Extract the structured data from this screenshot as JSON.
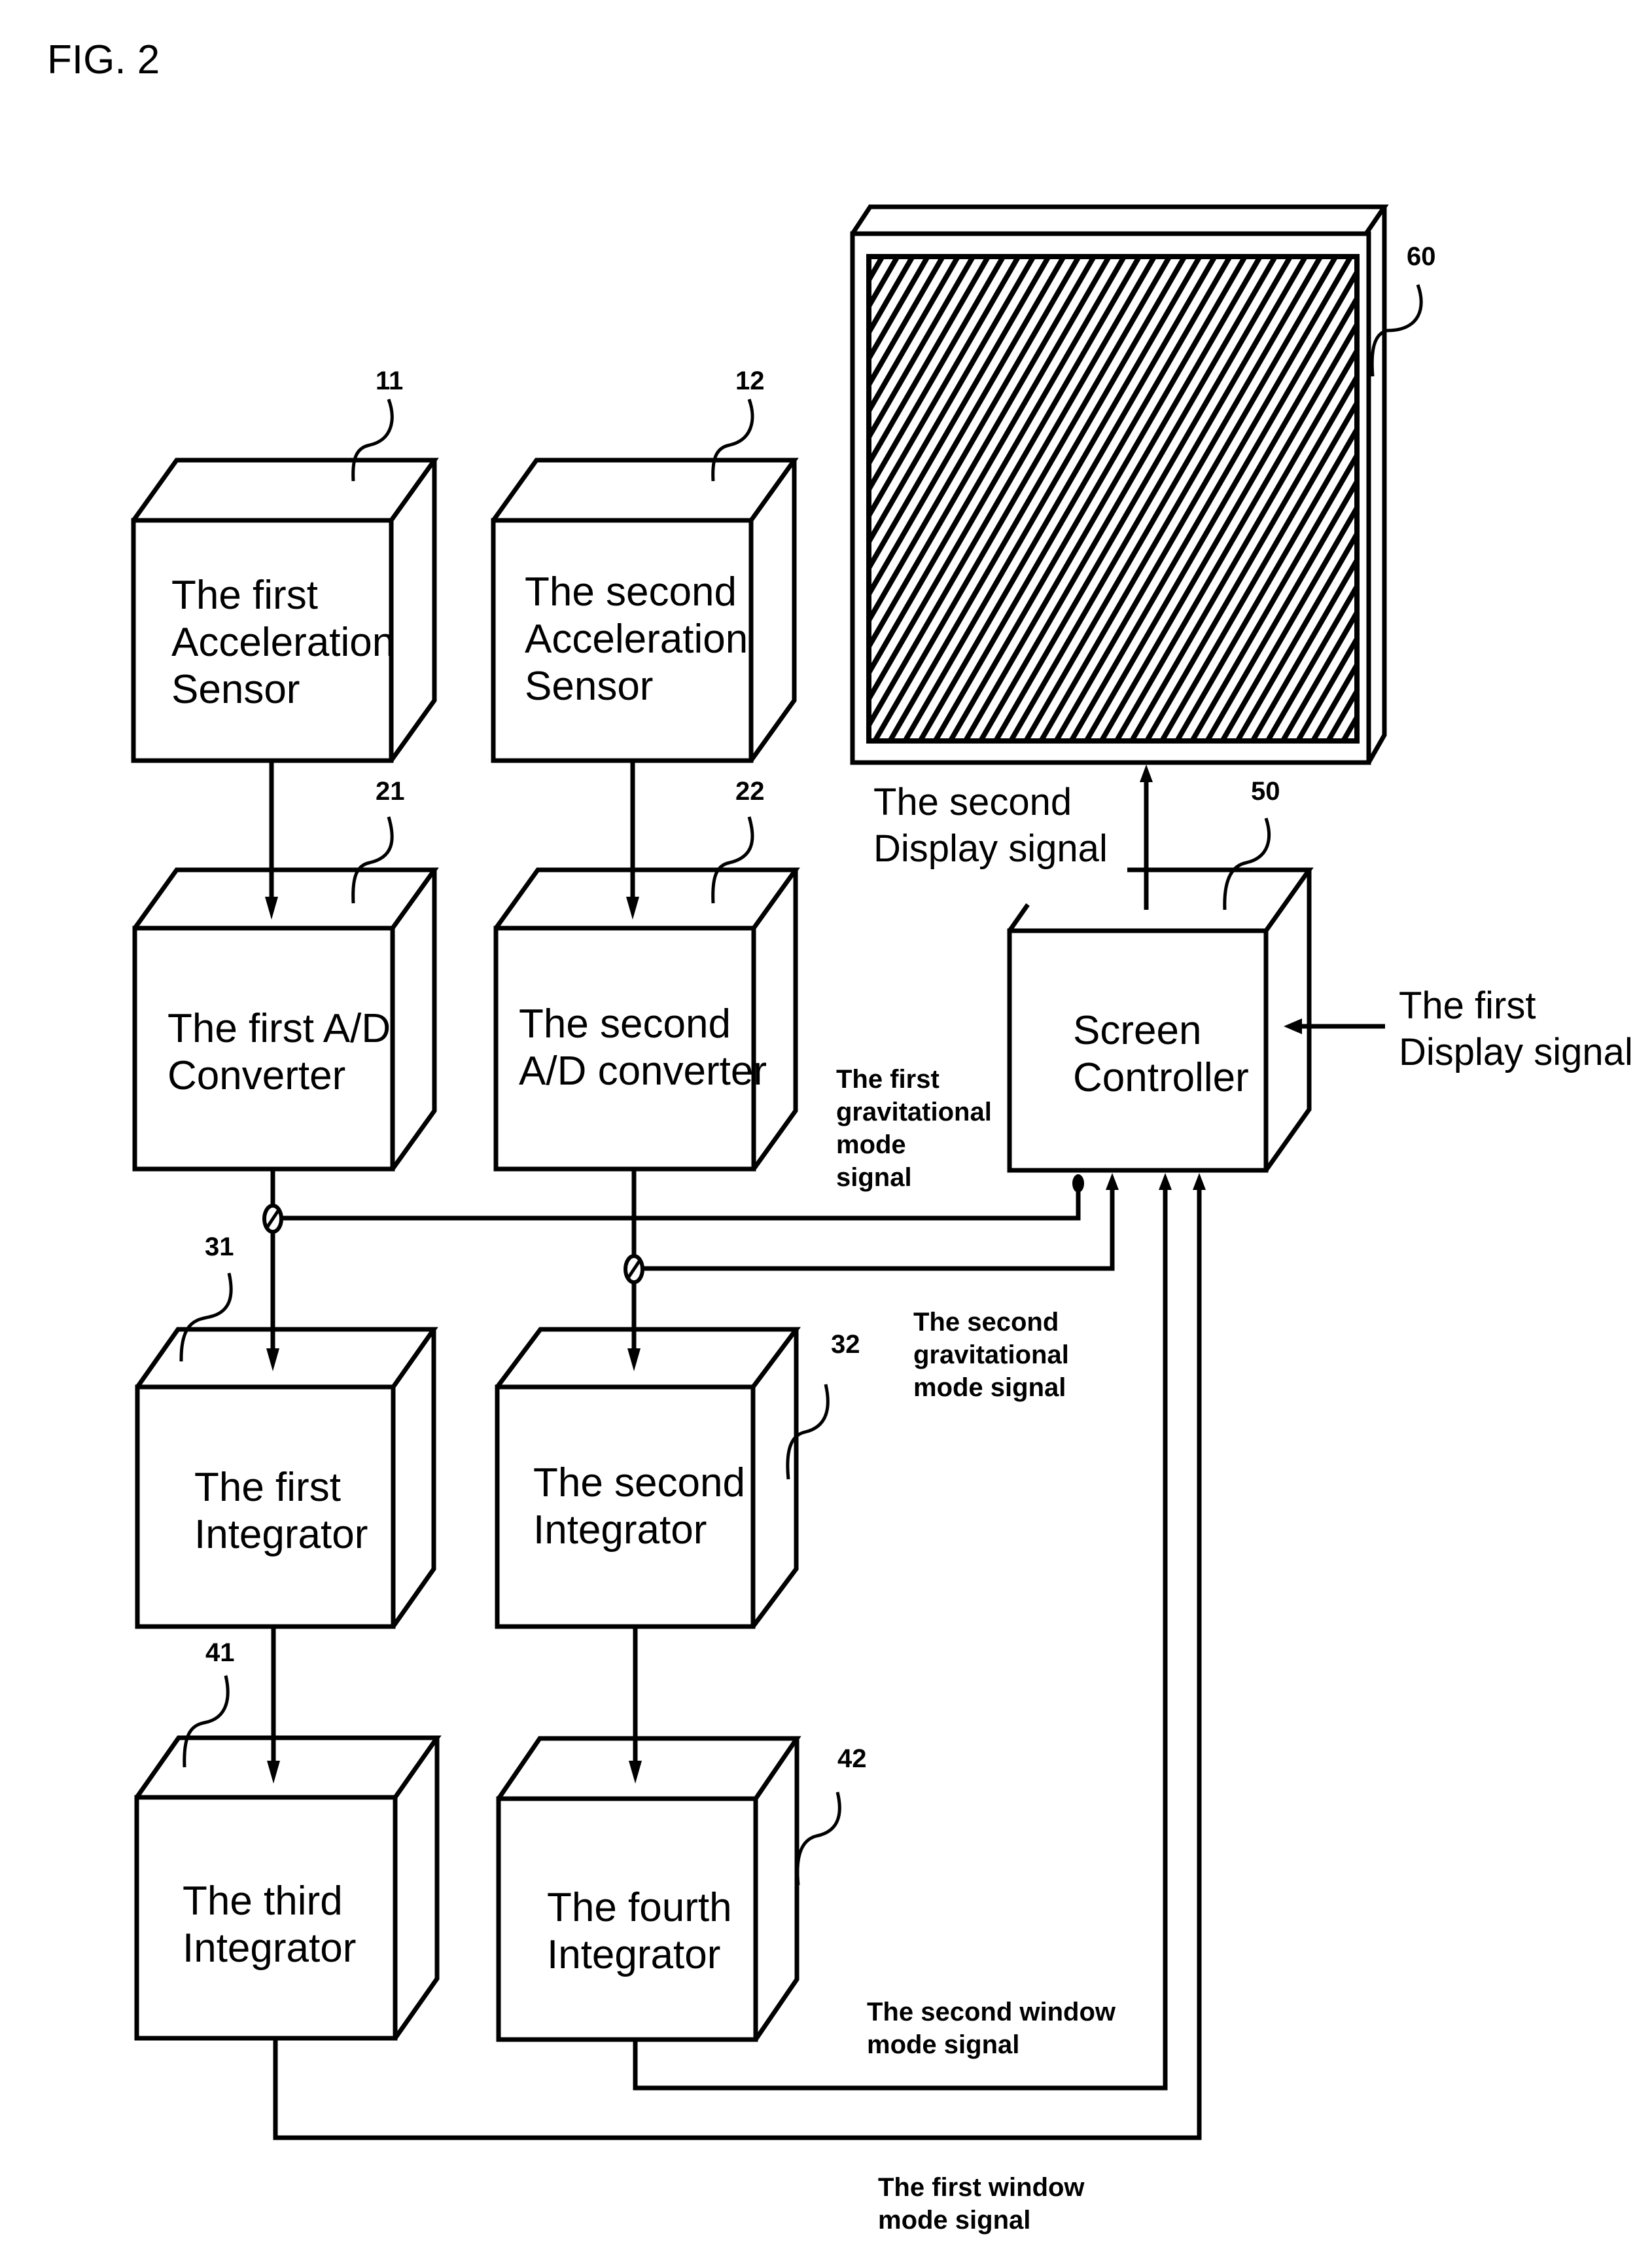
{
  "figure": {
    "title": "FIG. 2"
  },
  "colors": {
    "ink": "#000000",
    "paper": "#ffffff"
  },
  "blocks": [
    {
      "id": "11",
      "ref": "11",
      "lines": [
        "The first",
        "Acceleration",
        "Sensor"
      ]
    },
    {
      "id": "12",
      "ref": "12",
      "lines": [
        "The second",
        "Acceleration",
        "Sensor"
      ]
    },
    {
      "id": "21",
      "ref": "21",
      "lines": [
        "The first A/D",
        "Converter"
      ]
    },
    {
      "id": "22",
      "ref": "22",
      "lines": [
        "The second",
        "A/D converter"
      ]
    },
    {
      "id": "31",
      "ref": "31",
      "lines": [
        "The first",
        "Integrator"
      ]
    },
    {
      "id": "32",
      "ref": "32",
      "lines": [
        "The second",
        "Integrator"
      ]
    },
    {
      "id": "41",
      "ref": "41",
      "lines": [
        "The third",
        "Integrator"
      ]
    },
    {
      "id": "42",
      "ref": "42",
      "lines": [
        "The fourth",
        "Integrator"
      ]
    },
    {
      "id": "50",
      "ref": "50",
      "lines": [
        "Screen",
        "Controller"
      ]
    }
  ],
  "display": {
    "ref": "60",
    "icon": "hatched-display-screen"
  },
  "signals": {
    "second_display": [
      "The second",
      "Display signal"
    ],
    "first_display": [
      "The first",
      "Display signal"
    ],
    "first_gravitational": [
      "The first",
      "gravitational",
      "mode",
      "signal"
    ],
    "second_gravitational": [
      "The second",
      "gravitational",
      "mode signal"
    ],
    "second_window": [
      "The second window",
      "mode signal"
    ],
    "first_window": [
      "The first window",
      "mode signal"
    ]
  }
}
